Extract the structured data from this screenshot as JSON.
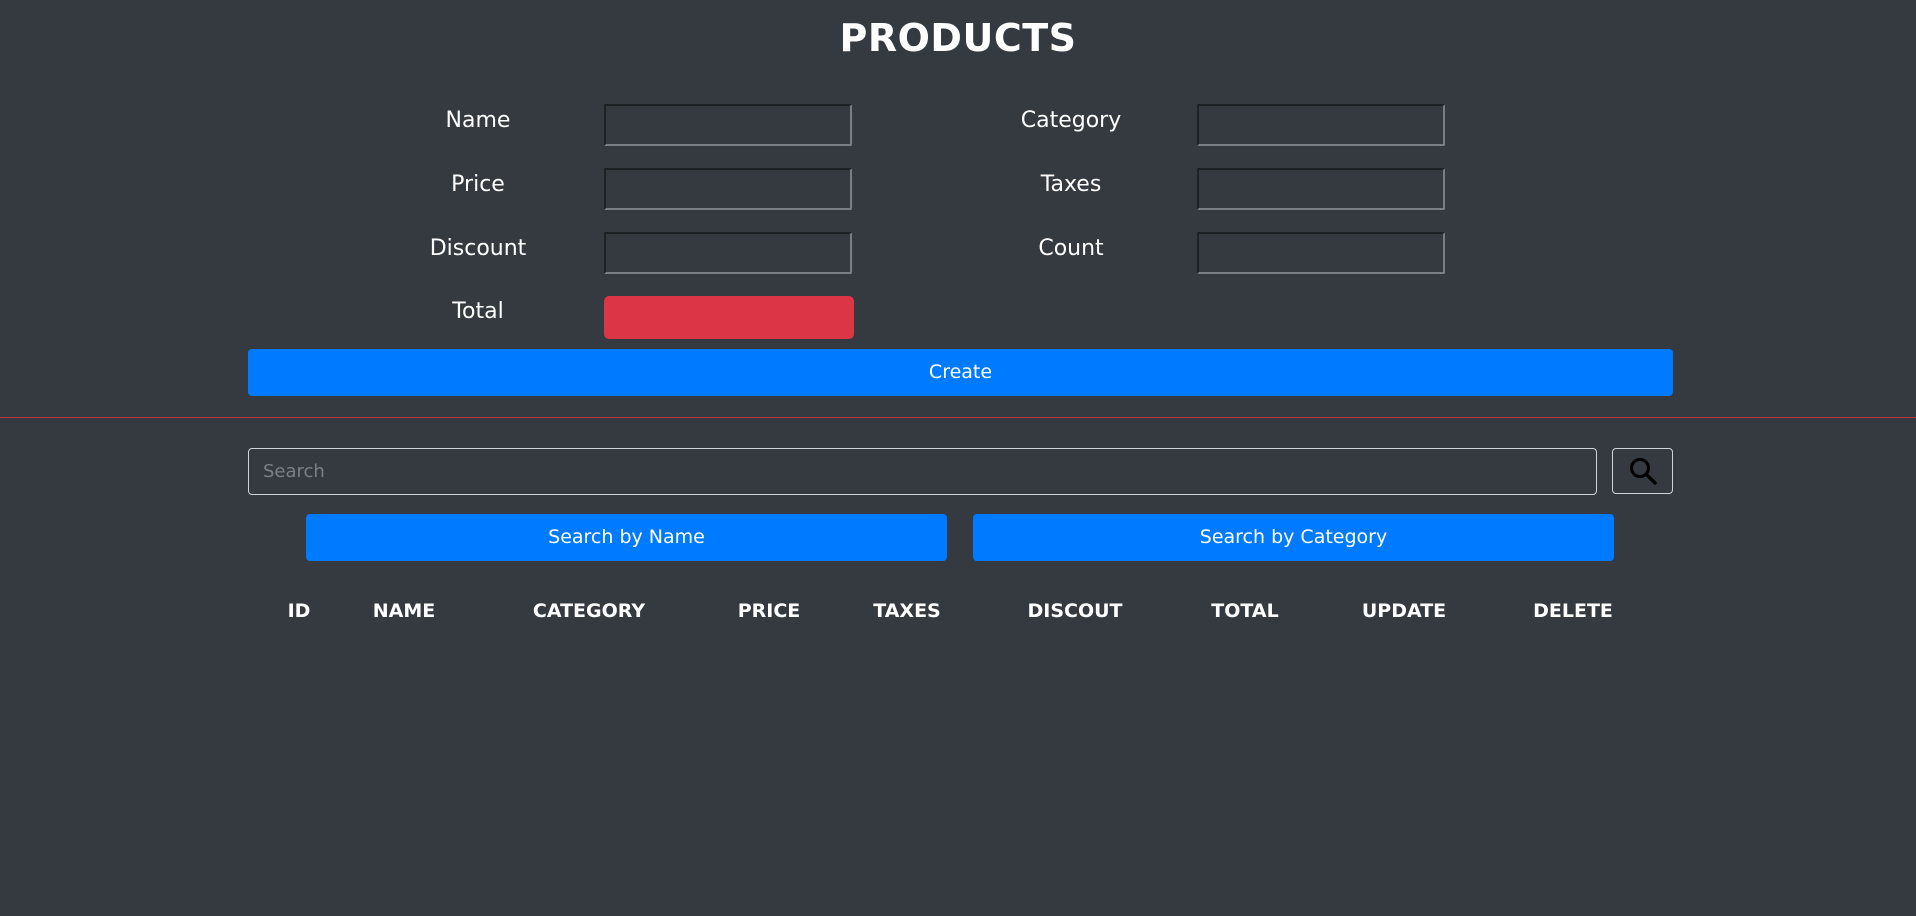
{
  "header": {
    "title": "PRODUCTS"
  },
  "form": {
    "name_label": "Name",
    "price_label": "Price",
    "discount_label": "Discount",
    "total_label": "Total",
    "category_label": "Category",
    "taxes_label": "Taxes",
    "count_label": "Count",
    "name_value": "",
    "price_value": "",
    "discount_value": "",
    "category_value": "",
    "taxes_value": "",
    "count_value": "",
    "total_value": "",
    "create_label": "Create"
  },
  "search": {
    "placeholder": "Search",
    "value": "",
    "by_name_label": "Search by Name",
    "by_category_label": "Search by Category"
  },
  "table": {
    "headers": [
      "ID",
      "NAME",
      "CATEGORY",
      "PRICE",
      "TAXES",
      "DISCOUT",
      "TOTAL",
      "UPDATE",
      "DELETE"
    ],
    "rows": []
  },
  "colors": {
    "background": "#343a40",
    "primary": "#007bff",
    "danger": "#dc3545",
    "divider": "#c0343f"
  },
  "icons": {
    "search_button": "search-icon"
  }
}
